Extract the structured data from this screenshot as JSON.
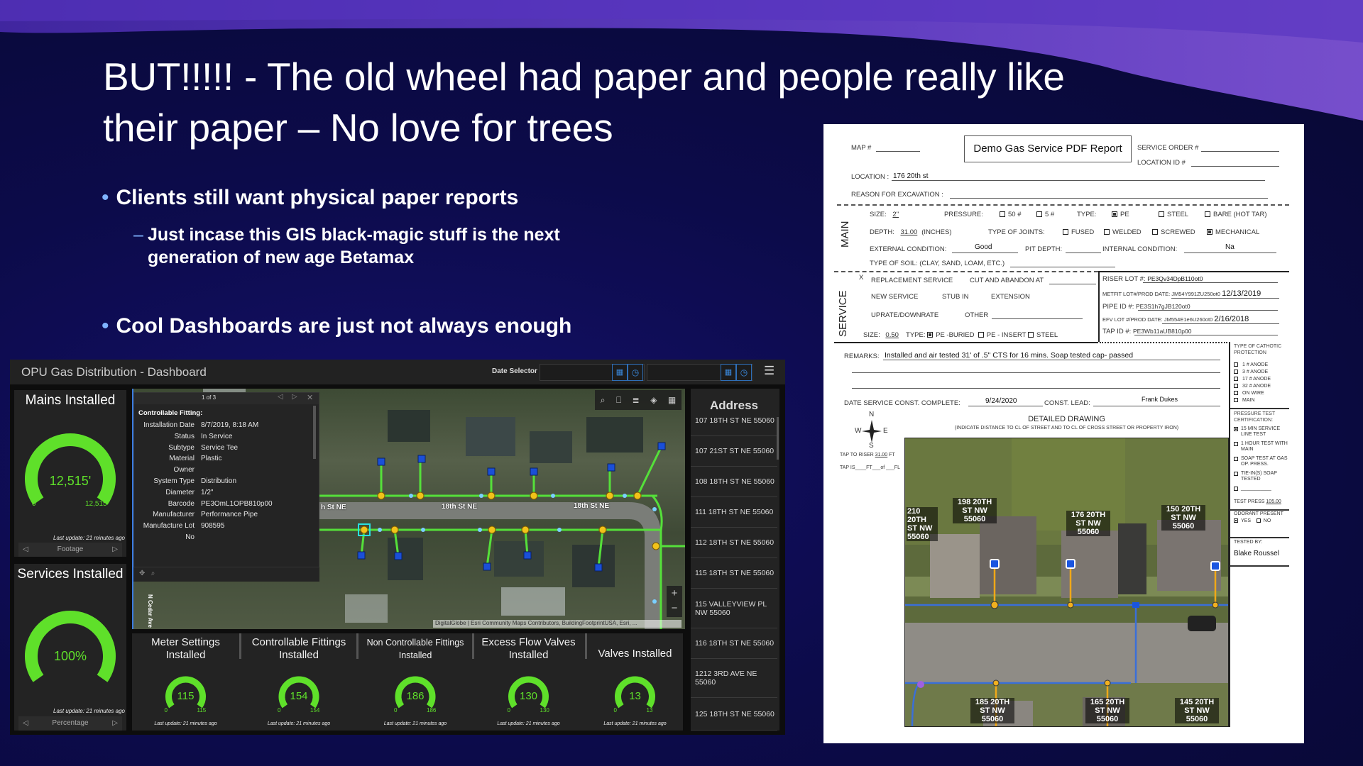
{
  "slide": {
    "title_line1": "BUT!!!!! -  The old wheel had paper and people really like",
    "title_line2": "their paper – No love for trees",
    "bullets": [
      {
        "text": "Clients still want physical paper reports"
      },
      {
        "text": "Cool Dashboards are just not always enough"
      }
    ],
    "sub_bullet_line1": "Just incase this GIS black-magic stuff is the next",
    "sub_bullet_line2": "generation of new age Betamax",
    "colors": {
      "accent_bullet": "#7fb3ff",
      "gauge_green": "#5fe02a",
      "background": "#0c0b4a",
      "wave": "#6a3fd0"
    }
  },
  "dashboard": {
    "title": "OPU Gas Distribution - Dashboard",
    "date_selector_label": "Date Selector",
    "icons": [
      "calendar-icon",
      "clock-icon",
      "hamburger-menu-icon"
    ],
    "mains": {
      "title": "Mains Installed",
      "value_label": "12,515'",
      "min_label": "0'",
      "max_label": "12,515",
      "min": 0,
      "max": 12515,
      "value": 12515,
      "last_update": "Last update: 21 minutes ago",
      "nav_label": "Footage"
    },
    "services": {
      "title": "Services Installed",
      "value_label": "100%",
      "min": 0,
      "max": 100,
      "value": 100,
      "last_update": "Last update: 21 minutes ago",
      "nav_label": "Percentage"
    },
    "popup": {
      "pager": "1 of 3",
      "heading": "Controllable Fitting:",
      "fields": [
        {
          "k": "Installation Date",
          "v": "8/7/2019, 8:18 AM"
        },
        {
          "k": "Status",
          "v": "In Service"
        },
        {
          "k": "Subtype",
          "v": "Service Tee"
        },
        {
          "k": "Material",
          "v": "Plastic"
        },
        {
          "k": "Owner",
          "v": ""
        },
        {
          "k": "System Type",
          "v": "Distribution"
        },
        {
          "k": "Diameter",
          "v": "1/2\""
        },
        {
          "k": "Barcode",
          "v": "PE3OmL1OPB810p00"
        },
        {
          "k": "Manufacturer",
          "v": "Performance Pipe"
        },
        {
          "k": "Manufacture Lot",
          "v": "908595"
        },
        {
          "k": "No",
          "v": ""
        }
      ]
    },
    "map": {
      "street_labels": [
        "h St NE",
        "18th St NE",
        "18th St NE"
      ],
      "side_street": "N Cedar Ave",
      "attribution": "DigitalGlobe | Esri Community Maps Contributors, BuildingFootprintUSA, Esri, ...",
      "zoom_in": "+",
      "zoom_out": "−",
      "tools": [
        "search-icon",
        "bookmark-icon",
        "legend-icon",
        "layers-icon",
        "basemap-icon"
      ]
    },
    "indicators": [
      {
        "title": "Meter Settings Installed",
        "value": 115,
        "min": 0,
        "max": 115,
        "last_update": "Last update: 21 minutes ago"
      },
      {
        "title": "Controllable Fittings Installed",
        "value": 154,
        "min": 0,
        "max": 154,
        "last_update": "Last update: 21 minutes ago"
      },
      {
        "title": "Non Controllable Fittings Installed",
        "value": 186,
        "min": 0,
        "max": 186,
        "last_update": "Last update: 21 minutes ago"
      },
      {
        "title": "Excess Flow Valves Installed",
        "value": 130,
        "min": 0,
        "max": 130,
        "last_update": "Last update: 21 minutes ago"
      },
      {
        "title": "Valves Installed",
        "value": 13,
        "min": 0,
        "max": 13,
        "last_update": "Last update: 21 minutes ago"
      }
    ],
    "address": {
      "header": "Address",
      "items": [
        "107 18TH ST NE 55060",
        "107 21ST ST NE 55060",
        "108 18TH ST NE 55060",
        "111 18TH ST NE 55060",
        "112 18TH ST NE 55060",
        "115 18TH ST NE 55060",
        "115 VALLEYVIEW PL NW 55060",
        "116 18TH ST NE 55060",
        "1212 3RD AVE NE 55060",
        "125 18TH ST NE 55060"
      ]
    }
  },
  "report": {
    "title": "Demo Gas Service PDF Report",
    "map_label": "MAP #",
    "service_order_label": "SERVICE ORDER #",
    "location_id_label": "LOCATION ID #",
    "location_label": "LOCATION :",
    "location_value": "176 20th st",
    "reason_label": "REASON FOR EXCAVATION :",
    "main": {
      "section": "MAIN",
      "size_label": "SIZE:",
      "size_value": "2\"",
      "pressure_label": "PRESSURE:",
      "p50": "50 #",
      "p5": "5 #",
      "type_label": "TYPE:",
      "pe": "PE",
      "steel": "STEEL",
      "bare": "BARE (HOT TAR)",
      "depth_label": "DEPTH:",
      "depth_value": "31.00",
      "depth_unit": "(INCHES)",
      "joints_label": "TYPE OF JOINTS:",
      "fused": "FUSED",
      "welded": "WELDED",
      "screwed": "SCREWED",
      "mechanical": "MECHANICAL",
      "ext_label": "EXTERNAL CONDITION:",
      "ext_value": "Good",
      "pit_label": "PIT DEPTH:",
      "int_label": "INTERNAL CONDITION:",
      "int_value": "Na",
      "soil_label": "TYPE OF SOIL: (CLAY, SAND, LOAM, ETC.)"
    },
    "service": {
      "section": "SERVICE",
      "x_mark": "X",
      "replacement": "REPLACEMENT SERVICE",
      "cut": "CUT AND ABANDON AT",
      "new": "NEW SERVICE",
      "stub": "STUB IN",
      "extension": "EXTENSION",
      "uprate": "UPRATE/DOWNRATE",
      "other": "OTHER",
      "size_label": "SIZE:",
      "size_value": "0.50",
      "type_label": "TYPE:",
      "pe_buried": "PE -BURIED",
      "pe_insert": "PE - INSERT",
      "steel": "STEEL",
      "riser_label": "RISER LOT #:",
      "riser_value": "PE3Qv34DpB110ot0",
      "metfit_label": "METFIT LOT#/PROD DATE:",
      "metfit_value": "JM54Y991ZU250ot0",
      "metfit_date": "12/13/2019",
      "pipe_label": "PIPE ID #:",
      "pipe_value": "PE3S1h7gJB120ot0",
      "efv_label": "EFV LOT #/PROD DATE:",
      "efv_value": "JM554E1e6U260ot0",
      "efv_date": "2/16/2018",
      "tap_label": "TAP ID #:",
      "tap_value": "PE3Wb11aUB810p00"
    },
    "remarks_label": "REMARKS:",
    "remarks_value": "Installed and air tested 31' of .5\" CTS for 16 mins. Soap tested cap- passed",
    "date_complete_label": "DATE SERVICE CONST. COMPLETE:",
    "date_complete_value": "9/24/2020",
    "const_lead_label": "CONST. LEAD:",
    "const_lead_value": "Frank Dukes",
    "compass": {
      "n": "N",
      "s": "S",
      "e": "E",
      "w": "W"
    },
    "tap_to_riser_label": "TAP TO RISER",
    "tap_to_riser_value": "31.00",
    "tap_to_riser_unit": "FT",
    "tap_is": "TAP IS____FT___of ___FL",
    "drawing_title": "DETAILED DRAWING",
    "drawing_subtitle": "(INDICATE DISTANCE TO CL OF STREET AND TO CL OF CROSS STREET OR PROPERTY IRON)",
    "drawing_labels": [
      "210 20TH ST NW 55060",
      "198 20TH ST NW 55060",
      "176 20TH ST NW 55060",
      "150 20TH ST NW 55060",
      "185 20TH ST NW 55060",
      "165 20TH ST NW 55060",
      "145 20TH ST NW 55060"
    ],
    "cathodic": {
      "title": "TYPE OF CATHOTIC PROTECTION",
      "items": [
        "1 # ANODE",
        "3 # ANODE",
        "17 # ANODE",
        "32 # ANODE",
        "ON WIRE",
        "MAIN"
      ]
    },
    "pressure_test": {
      "title": "PRESSURE TEST CERTIFICATION:",
      "items": [
        "15 MIN SERVICE LINE TEST",
        "1 HOUR TEST WITH MAIN",
        "SOAP TEST AT GAS OP. PRESS.",
        "TIE-IN(S) SOAP TESTED",
        "___________"
      ],
      "checked": [
        true,
        false,
        false,
        false,
        false
      ],
      "test_press_label": "TEST PRESS",
      "test_press_value": "105.00"
    },
    "odorant": {
      "title": "ODORANT PRESENT",
      "yes": "YES",
      "no": "NO",
      "yes_checked": true
    },
    "tested_by_label": "TESTED BY:",
    "tested_by_value": "Blake Roussel"
  }
}
